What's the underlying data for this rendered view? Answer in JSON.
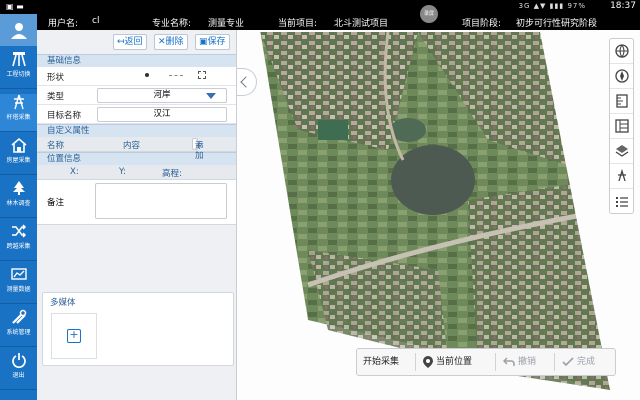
{
  "statusbar": {
    "time": "18:37",
    "indicators": "3G ▲▼ ▮▮▮ 97%"
  },
  "header": {
    "user_label": "用户名:",
    "user_value": "cl",
    "major_label": "专业名称:",
    "major_value": "测量专业",
    "project_label": "当前项目:",
    "project_value": "北斗测试项目",
    "stage_label": "项目阶段:",
    "stage_value": "初步可行性研究阶段",
    "record_button": "录屏"
  },
  "sidebar": {
    "items": [
      {
        "label": "工程切换",
        "icon": "survey-tripod-icon"
      },
      {
        "label": "杆塔采集",
        "icon": "tower-icon"
      },
      {
        "label": "房屋采集",
        "icon": "house-icon"
      },
      {
        "label": "林木调查",
        "icon": "tree-icon"
      },
      {
        "label": "跨越采集",
        "icon": "crossing-icon"
      },
      {
        "label": "测量数据",
        "icon": "measure-data-icon"
      },
      {
        "label": "系统管理",
        "icon": "tools-icon"
      },
      {
        "label": "退出",
        "icon": "power-icon"
      }
    ]
  },
  "toolbar": {
    "back_label": "返回",
    "delete_label": "删除",
    "save_label": "保存"
  },
  "basic_info": {
    "title": "基础信息",
    "shape_label": "形状",
    "shape_options": [
      "point",
      "line",
      "polygon"
    ],
    "type_label": "类型",
    "type_value": "河岸",
    "target_name_label": "目标名称",
    "target_name_value": "汉江"
  },
  "custom_attrs": {
    "title": "自定义属性",
    "col_name": "名称",
    "col_content": "内容",
    "add_label": "添加"
  },
  "position": {
    "title": "位置信息",
    "x_label": "X:",
    "y_label": "Y:",
    "elev_label": "高程:"
  },
  "memo": {
    "label": "备注",
    "value": ""
  },
  "media": {
    "title": "多媒体"
  },
  "map_tools": [
    "globe-icon",
    "compass-icon",
    "ruler-icon",
    "layout-icon",
    "layers-icon",
    "tower-list-icon",
    "list-icon"
  ],
  "bottombar": {
    "start_label": "开始采集",
    "location_label": "当前位置",
    "undo_label": "撤销",
    "done_label": "完成"
  },
  "colors": {
    "nav_blue": "#1a72c4",
    "section_bg": "#d6e4f2",
    "header_bg": "#000000"
  }
}
